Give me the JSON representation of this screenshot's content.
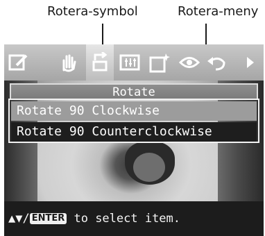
{
  "callouts": {
    "symbol_label": "Rotera-symbol",
    "menu_label": "Rotera-meny"
  },
  "toolbar": {
    "icons": [
      "edit-icon",
      "hand-icon",
      "rotate-icon",
      "adjust-icon",
      "frame-icon",
      "eye-icon",
      "undo-icon",
      "next-arrow-icon"
    ],
    "selected": "rotate-icon"
  },
  "menu": {
    "title": "Rotate",
    "items": [
      {
        "label": "Rotate 90 Clockwise",
        "selected": true
      },
      {
        "label": "Rotate 90 Counterclockwise",
        "selected": false
      }
    ]
  },
  "status": {
    "arrows": "▲▼/",
    "enter_key": "ENTER",
    "text": " to select item."
  }
}
